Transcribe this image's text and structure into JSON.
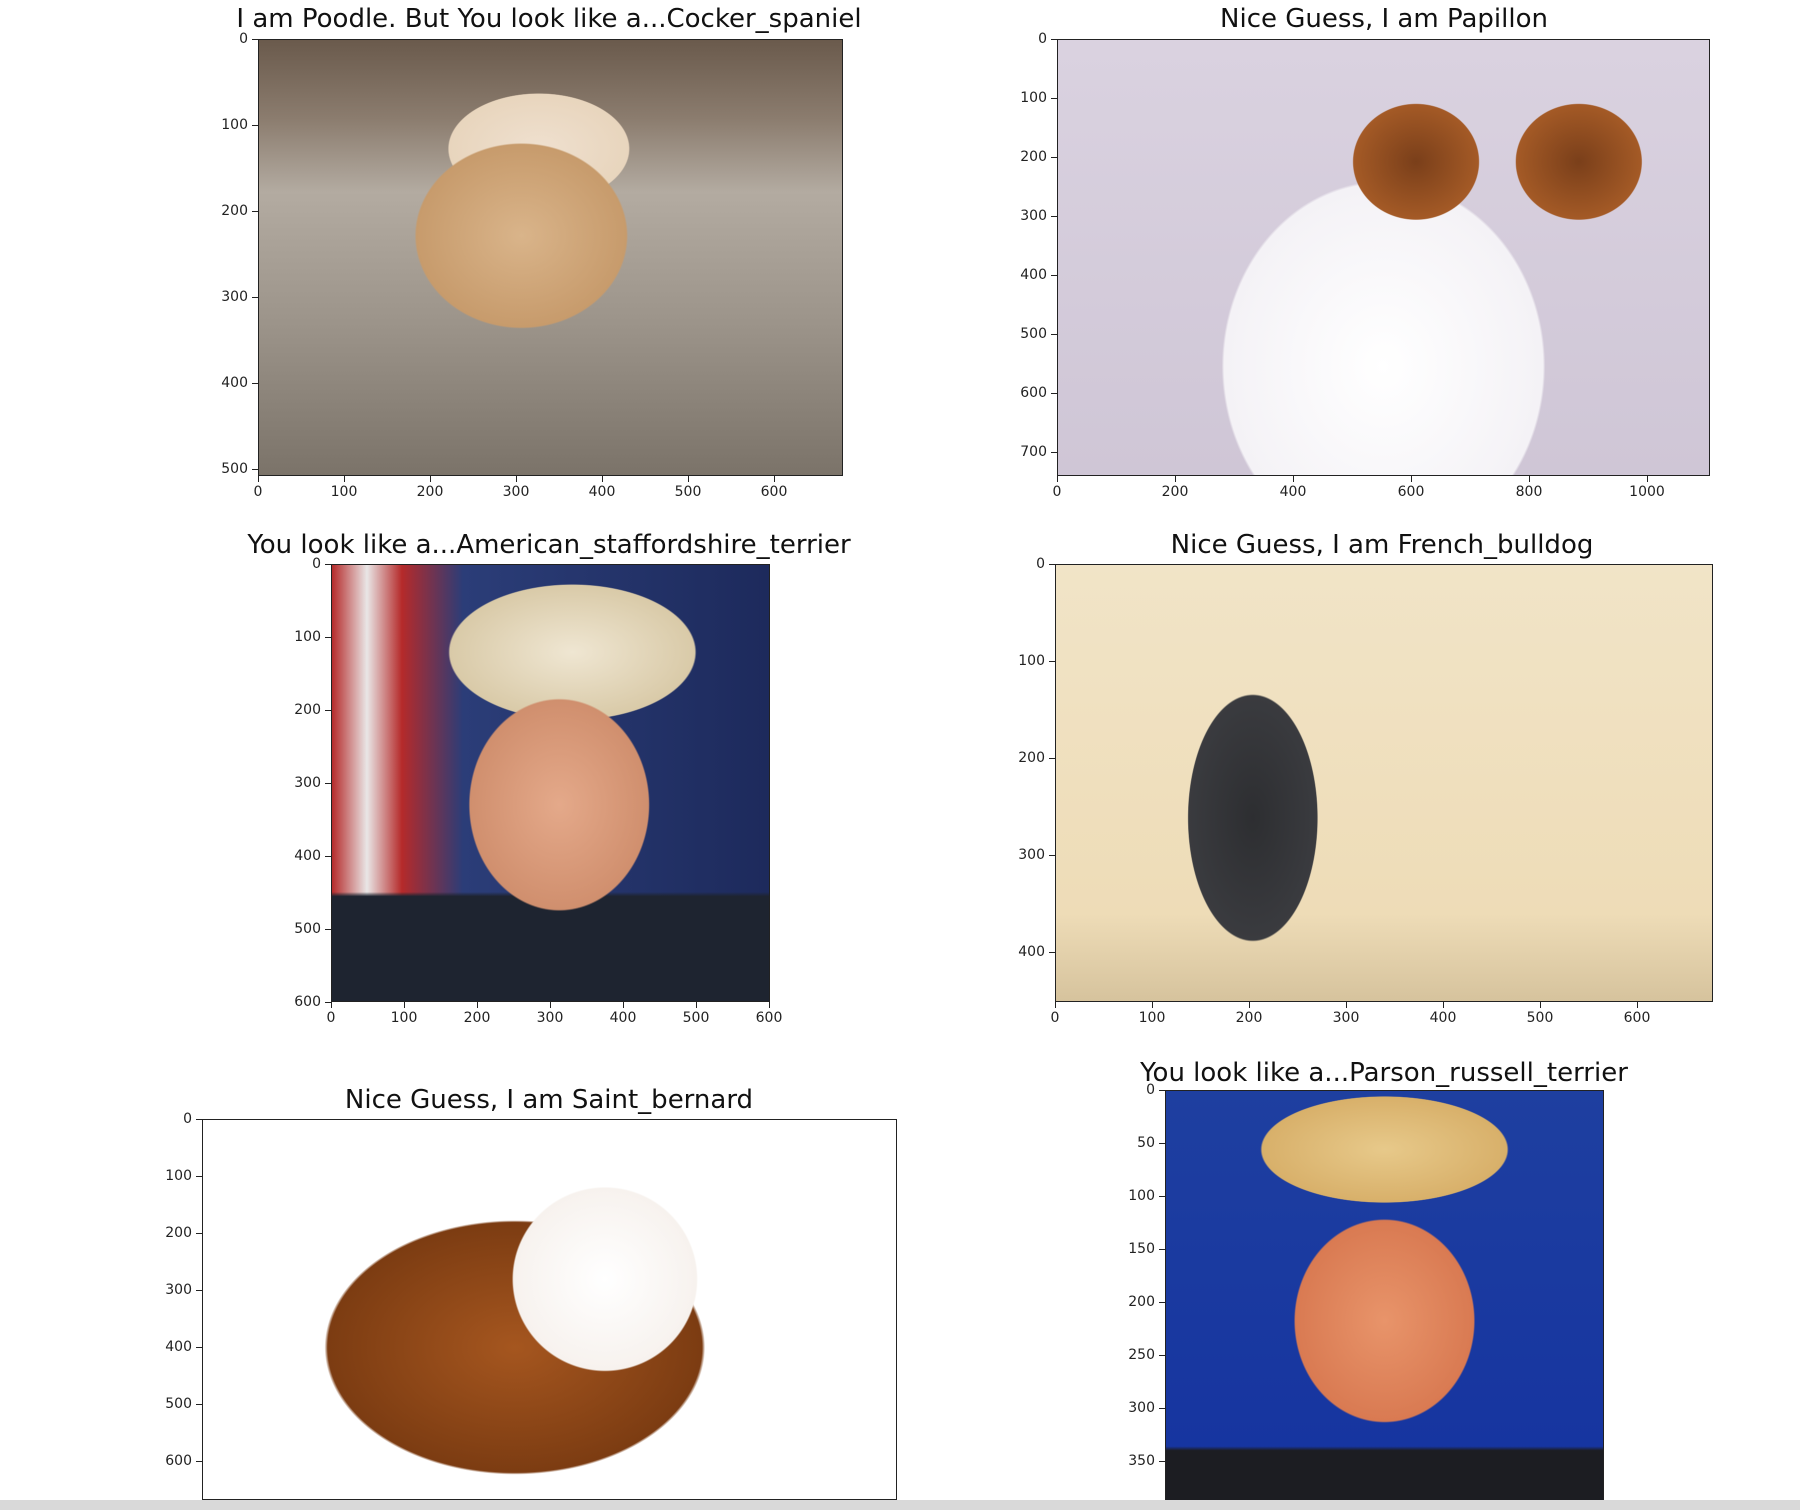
{
  "panels": [
    {
      "title": "I am Poodle. But You look like a...Cocker_spaniel",
      "image_subject": "poodle-dog-photo",
      "y_ticks": [
        "0",
        "100",
        "200",
        "300",
        "400",
        "500"
      ],
      "x_ticks": [
        "0",
        "100",
        "200",
        "300",
        "400",
        "500",
        "600"
      ]
    },
    {
      "title": "Nice Guess, I am Papillon",
      "image_subject": "papillon-dog-photo",
      "y_ticks": [
        "0",
        "100",
        "200",
        "300",
        "400",
        "500",
        "600",
        "700"
      ],
      "x_ticks": [
        "0",
        "200",
        "400",
        "600",
        "800",
        "1000"
      ]
    },
    {
      "title": "You look like a...American_staffordshire_terrier",
      "image_subject": "smiling-man-portrait-flag",
      "y_ticks": [
        "0",
        "100",
        "200",
        "300",
        "400",
        "500",
        "600"
      ],
      "x_ticks": [
        "0",
        "100",
        "200",
        "300",
        "400",
        "500",
        "600"
      ]
    },
    {
      "title": "Nice Guess, I am French_bulldog",
      "image_subject": "french-bulldog-photo",
      "y_ticks": [
        "0",
        "100",
        "200",
        "300",
        "400"
      ],
      "x_ticks": [
        "0",
        "100",
        "200",
        "300",
        "400",
        "500",
        "600"
      ]
    },
    {
      "title": "Nice Guess, I am Saint_bernard",
      "image_subject": "saint-bernard-dog-photo",
      "y_ticks": [
        "0",
        "100",
        "200",
        "300",
        "400",
        "500",
        "600"
      ],
      "x_ticks": []
    },
    {
      "title": "You look like a...Parson_russell_terrier",
      "image_subject": "man-portrait-blue-background",
      "y_ticks": [
        "0",
        "50",
        "100",
        "150",
        "200",
        "250",
        "300",
        "350"
      ],
      "x_ticks": []
    }
  ]
}
